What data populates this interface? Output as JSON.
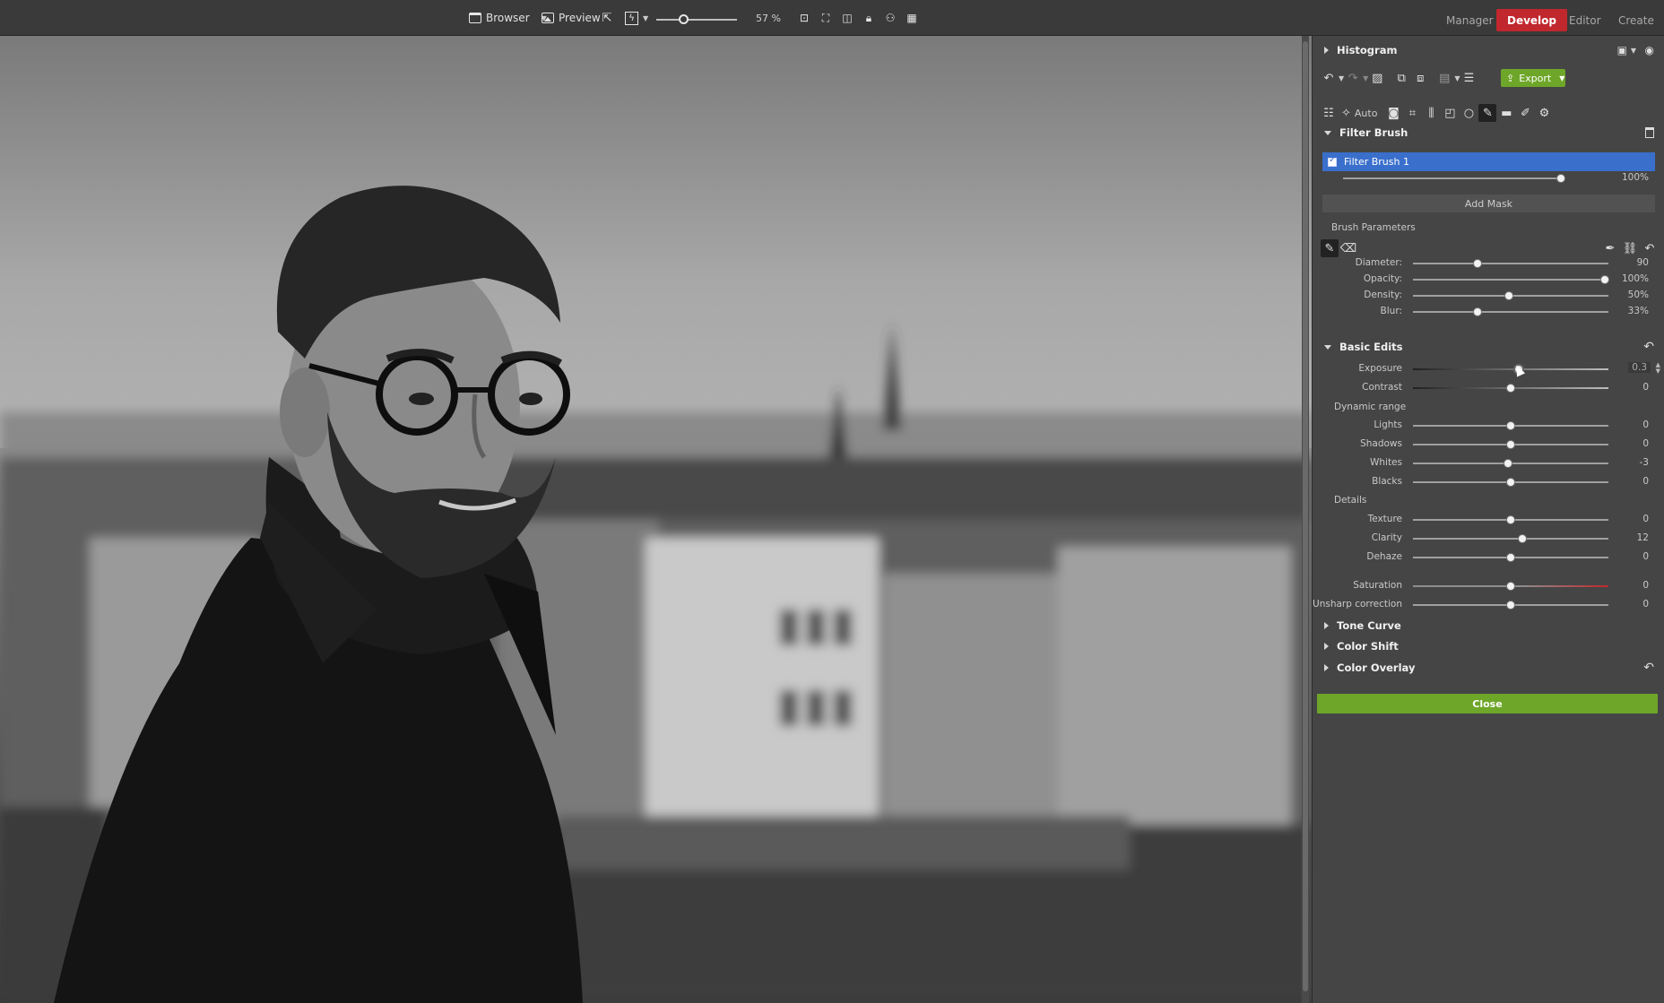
{
  "topbar": {
    "browser_label": "Browser",
    "preview_label": "Preview",
    "zoom_value": "57 %",
    "zoom_fraction": 0.33,
    "modes": [
      {
        "label": "Manager",
        "active": false
      },
      {
        "label": "Develop",
        "active": true
      },
      {
        "label": "Editor",
        "active": false
      },
      {
        "label": "Create",
        "active": false
      }
    ]
  },
  "colors": {
    "accent_red": "#c0282d",
    "accent_green": "#6ea629",
    "selection_blue": "#3a6fcc"
  },
  "panel": {
    "histogram_title": "Histogram",
    "export_label": "Export",
    "auto_label": "Auto",
    "filter_brush_title": "Filter Brush",
    "filter_brush_item": "Filter Brush 1",
    "filter_brush_opacity": "100%",
    "filter_brush_opacity_fraction": 1.0,
    "add_mask_label": "Add Mask",
    "brush_params_title": "Brush Parameters",
    "brush_params": [
      {
        "label": "Diameter:",
        "value": "90",
        "fraction": 0.33
      },
      {
        "label": "Opacity:",
        "value": "100%",
        "fraction": 0.98
      },
      {
        "label": "Density:",
        "value": "50%",
        "fraction": 0.49
      },
      {
        "label": "Blur:",
        "value": "33%",
        "fraction": 0.33
      }
    ],
    "basic_edits_title": "Basic Edits",
    "exposure": {
      "label": "Exposure",
      "value": "0.3",
      "fraction": 0.54
    },
    "contrast": {
      "label": "Contrast",
      "value": "0",
      "fraction": 0.5
    },
    "dynamic_range_label": "Dynamic range",
    "dynamic_range": [
      {
        "label": "Lights",
        "value": "0",
        "fraction": 0.5
      },
      {
        "label": "Shadows",
        "value": "0",
        "fraction": 0.5
      },
      {
        "label": "Whites",
        "value": "-3",
        "fraction": 0.485
      },
      {
        "label": "Blacks",
        "value": "0",
        "fraction": 0.5
      }
    ],
    "details_label": "Details",
    "details": [
      {
        "label": "Texture",
        "value": "0",
        "fraction": 0.5
      },
      {
        "label": "Clarity",
        "value": "12",
        "fraction": 0.56
      },
      {
        "label": "Dehaze",
        "value": "0",
        "fraction": 0.5
      }
    ],
    "saturation": {
      "label": "Saturation",
      "value": "0",
      "fraction": 0.5
    },
    "unsharp": {
      "label": "Unsharp correction",
      "value": "0",
      "fraction": 0.5
    },
    "tone_curve_title": "Tone Curve",
    "color_shift_title": "Color Shift",
    "color_overlay_title": "Color Overlay",
    "close_label": "Close"
  }
}
